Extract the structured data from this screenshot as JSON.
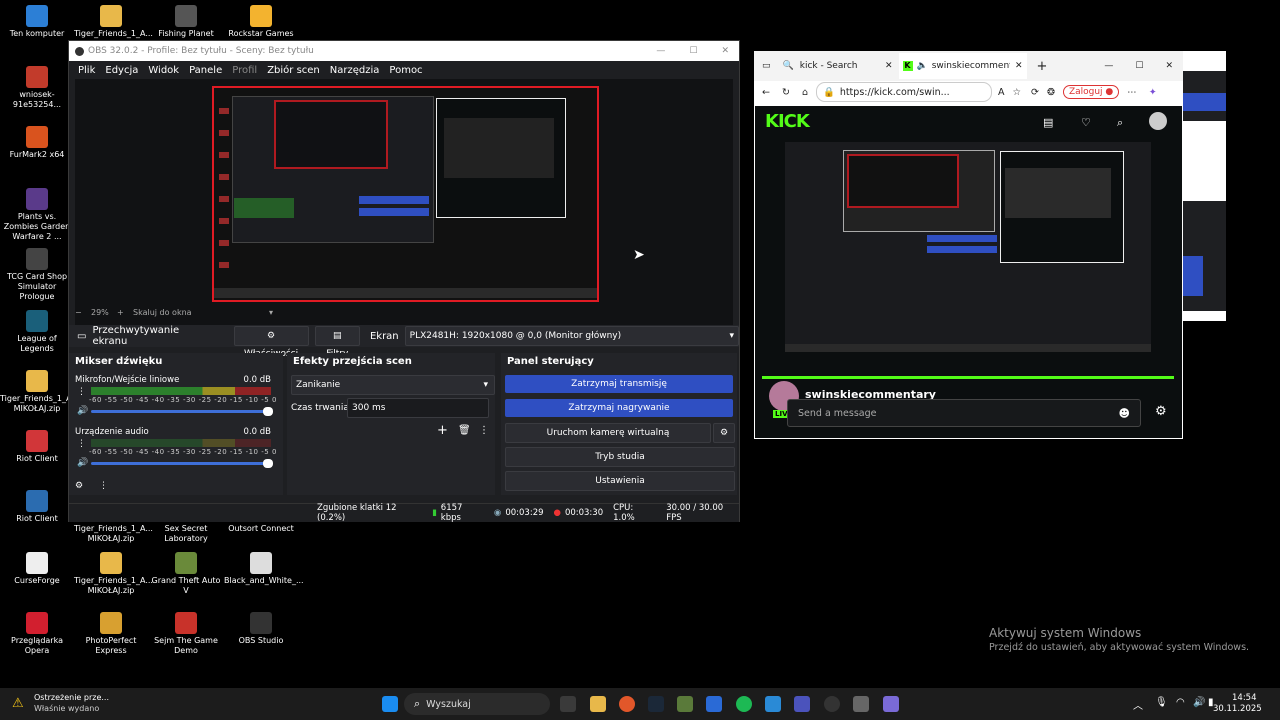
{
  "desktop": {
    "icons": [
      {
        "label": "Ten komputer",
        "color": "#2c7fd6"
      },
      {
        "label": "Tiger_Friends_1_A...",
        "color": "#e8b84a"
      },
      {
        "label": "Fishing Planet",
        "color": "#555"
      },
      {
        "label": "Rockstar Games",
        "color": "#f3b32f"
      },
      {
        "label": "wniosek-91e53254...",
        "color": "#c23b2b"
      },
      {
        "label": "FurMark2 x64",
        "color": "#d9531e"
      },
      {
        "label": "Plants vs. Zombies Garden Warfare 2 ...",
        "color": "#5a3a8a"
      },
      {
        "label": "TCG Card Shop Simulator Prologue",
        "color": "#444"
      },
      {
        "label": "League of Legends",
        "color": "#1a5f7a"
      },
      {
        "label": "Tiger_Friends_1_A... MIKOŁAJ.zip",
        "color": "#e8b84a"
      },
      {
        "label": "Riot Client",
        "color": "#d13639"
      },
      {
        "label": "Riot Client",
        "color": "#2b6cb0"
      },
      {
        "label": "Tiger_Friends_1_A... MIKOŁAJ.zip",
        "color": "#e8b84a"
      },
      {
        "label": "Sex Secret Laboratory",
        "color": "#444"
      },
      {
        "label": "Outsort Connect",
        "color": "#444"
      },
      {
        "label": "CurseForge",
        "color": "#eee"
      },
      {
        "label": "Tiger_Friends_1_A... MIKOŁAJ.zip",
        "color": "#e8b84a"
      },
      {
        "label": "Grand Theft Auto V",
        "color": "#6a8a3a"
      },
      {
        "label": "Black_and_White_...",
        "color": "#ddd"
      },
      {
        "label": "Przeglądarka Opera",
        "color": "#d21f2f"
      },
      {
        "label": "PhotoPerfect Express",
        "color": "#d8a030"
      },
      {
        "label": "Sejm The Game Demo",
        "color": "#c8322a"
      },
      {
        "label": "OBS Studio",
        "color": "#333"
      }
    ]
  },
  "obs": {
    "title": "OBS 32.0.2 - Profile: Bez tytułu - Sceny: Bez tytułu",
    "menu": [
      "Plik",
      "Edycja",
      "Widok",
      "Panele",
      "Profil",
      "Zbiór scen",
      "Narzędzia",
      "Pomoc"
    ],
    "zoom": "29%",
    "scale_label": "Skaluj do okna",
    "source_label": "Przechwytywanie ekranu",
    "properties_label": "Właściwości",
    "filters_label": "Filtry",
    "screen_label": "Ekran",
    "screen_value": "PLX2481H: 1920x1080 @ 0,0 (Monitor główny)",
    "mixer": {
      "title": "Mikser dźwięku",
      "channels": [
        {
          "name": "Mikrofon/Wejście liniowe",
          "db": "0.0 dB",
          "level": 0.55
        },
        {
          "name": "Urządzenie audio",
          "db": "0.0 dB",
          "level": 0.0
        }
      ],
      "ticks": "-60 -55 -50 -45 -40 -35 -30 -25 -20 -15 -10 -5 0"
    },
    "transitions": {
      "title": "Efekty przejścia scen",
      "selected": "Zanikanie",
      "duration_label": "Czas trwania",
      "duration_value": "300 ms"
    },
    "controls": {
      "title": "Panel sterujący",
      "stop_stream": "Zatrzymaj transmisję",
      "stop_record": "Zatrzymaj nagrywanie",
      "virtual_cam": "Uruchom kamerę wirtualną",
      "studio_mode": "Tryb studia",
      "settings": "Ustawienia"
    },
    "status": {
      "dropped": "Zgubione klatki 12 (0.2%)",
      "bitrate": "6157 kbps",
      "stream_time": "00:03:29",
      "rec_time": "00:03:30",
      "cpu": "CPU: 1.0%",
      "fps": "30.00 / 30.00 FPS"
    }
  },
  "browser": {
    "tabs": [
      {
        "label": "kick - Search"
      },
      {
        "label": "swinskiecommentar"
      }
    ],
    "url": "https://kick.com/swin...",
    "login": "Zaloguj",
    "site": {
      "logo": "KICK",
      "channel": "swinskiecommentary",
      "tag": "LIVE",
      "chat_placeholder": "Send a message"
    }
  },
  "taskbar": {
    "notification_title": "Ostrzeżenie prze...",
    "notification_sub": "Właśnie wydano",
    "search_placeholder": "Wyszukaj",
    "time": "14:54",
    "date": "30.11.2025"
  },
  "watermark": {
    "title": "Aktywuj system Windows",
    "sub": "Przejdź do ustawień, aby aktywować system Windows."
  }
}
